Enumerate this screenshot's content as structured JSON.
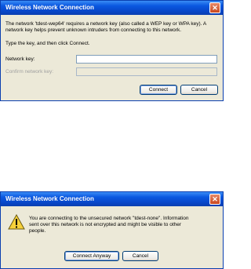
{
  "dialog_key": {
    "title": "Wireless Network Connection",
    "close_glyph": "✕",
    "message_line1": "The network 'tdest-wep64' requires a network key (also called a WEP key or WPA key). A",
    "message_line2": "network key helps prevent unknown intruders from connecting to this network.",
    "instruction": "Type the key, and then click Connect.",
    "network_key_label": "Network key:",
    "network_key_value": "",
    "confirm_key_label": "Confirm network key:",
    "confirm_key_value": "",
    "connect_label": "Connect",
    "cancel_label": "Cancel"
  },
  "dialog_unsecured": {
    "title": "Wireless Network Connection",
    "close_glyph": "✕",
    "icon": "warning-icon",
    "message_line1": "You are connecting to the unsecured network \"tdest-none\". Information",
    "message_line2": "sent over this network is not encrypted and might be visible to other",
    "message_line3": "people.",
    "connect_anyway_label": "Connect Anyway",
    "cancel_label": "Cancel"
  },
  "colors": {
    "titlebar": "#0a58e0",
    "dialog_bg": "#ece9d8",
    "close_button": "#c8471f"
  }
}
